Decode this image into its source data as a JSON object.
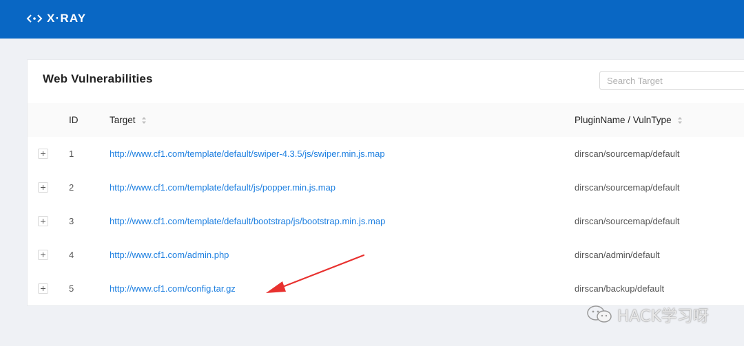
{
  "header": {
    "logo_text": "X·RAY",
    "logo_icon": "code-brackets-icon",
    "background_color": "#0967c4"
  },
  "panel": {
    "title": "Web Vulnerabilities",
    "search_placeholder": "Search Target"
  },
  "table": {
    "columns": {
      "id": "ID",
      "target": "Target",
      "plugin": "PluginName / VulnType"
    },
    "rows": [
      {
        "id": "1",
        "target": "http://www.cf1.com/template/default/swiper-4.3.5/js/swiper.min.js.map",
        "plugin": "dirscan/sourcemap/default"
      },
      {
        "id": "2",
        "target": "http://www.cf1.com/template/default/js/popper.min.js.map",
        "plugin": "dirscan/sourcemap/default"
      },
      {
        "id": "3",
        "target": "http://www.cf1.com/template/default/bootstrap/js/bootstrap.min.js.map",
        "plugin": "dirscan/sourcemap/default"
      },
      {
        "id": "4",
        "target": "http://www.cf1.com/admin.php",
        "plugin": "dirscan/admin/default"
      },
      {
        "id": "5",
        "target": "http://www.cf1.com/config.tar.gz",
        "plugin": "dirscan/backup/default"
      }
    ]
  },
  "annotation": {
    "arrow_color": "#e8312f"
  },
  "watermark": {
    "text": "HACK学习呀",
    "icon": "wechat-icon"
  }
}
